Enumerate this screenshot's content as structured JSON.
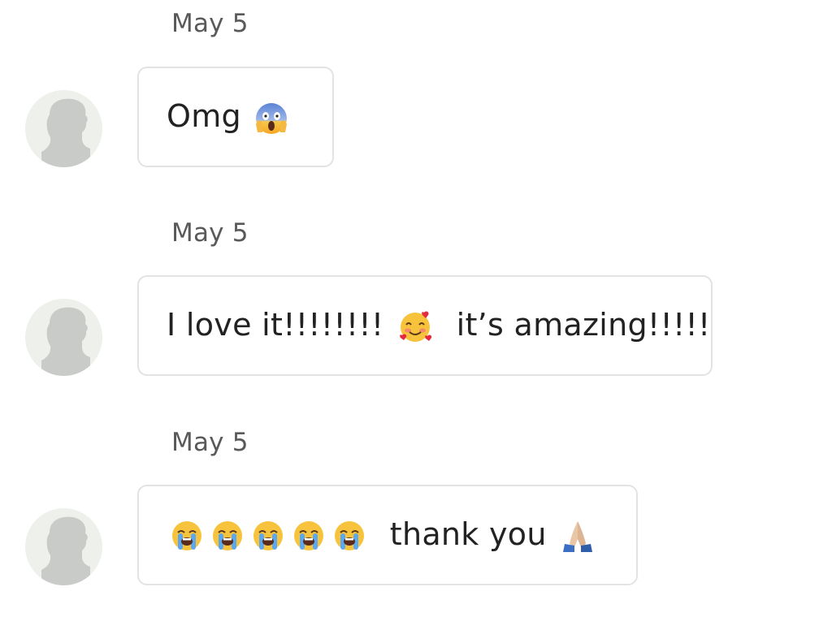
{
  "messages": [
    {
      "date": "May 5",
      "parts": [
        {
          "text": "Omg "
        },
        {
          "emoji": "screaming-face-emoji"
        }
      ]
    },
    {
      "date": "May 5",
      "parts": [
        {
          "text": "I love it!!!!!!!! "
        },
        {
          "emoji": "smiling-face-with-hearts-emoji"
        },
        {
          "text": "  it’s amazing!!!!!"
        }
      ]
    },
    {
      "date": "May 5",
      "parts": [
        {
          "emoji": "loudly-crying-face-emoji"
        },
        {
          "emoji": "loudly-crying-face-emoji"
        },
        {
          "emoji": "loudly-crying-face-emoji"
        },
        {
          "emoji": "loudly-crying-face-emoji"
        },
        {
          "emoji": "loudly-crying-face-emoji"
        },
        {
          "text": "  thank you "
        },
        {
          "emoji": "folded-hands-emoji"
        }
      ]
    }
  ],
  "icons": {
    "avatar": "default-user-avatar-icon"
  },
  "colors": {
    "date_text": "#595959",
    "bubble_border": "#e3e3e3",
    "avatar_bg": "#eef0ec",
    "avatar_silhouette": "#c9cbc8"
  }
}
